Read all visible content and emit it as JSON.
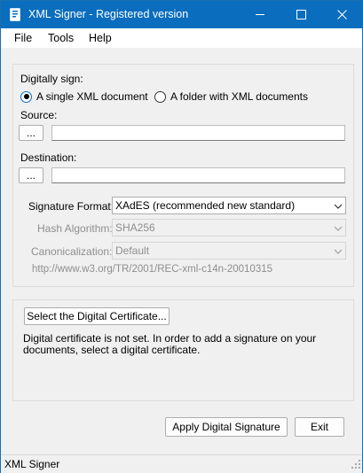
{
  "titlebar": {
    "title": "XML Signer - Registered version",
    "controls": [
      "minimize-icon",
      "maximize-icon",
      "close-icon"
    ]
  },
  "menu": {
    "file": "File",
    "tools": "Tools",
    "help": "Help"
  },
  "sign": {
    "heading": "Digitally sign:",
    "options": {
      "single": "A single XML document",
      "folder": "A folder with XML documents"
    },
    "selected": "single"
  },
  "source": {
    "label": "Source:",
    "browse": "...",
    "value": ""
  },
  "destination": {
    "label": "Destination:",
    "browse": "...",
    "value": ""
  },
  "signature": {
    "format_label": "Signature Format:",
    "format_value": "XAdES (recommended new standard)",
    "hash_label": "Hash Algorithm:",
    "hash_value": "SHA256",
    "canon_label": "Canonicalization:",
    "canon_value": "Default",
    "canon_url": "http://www.w3.org/TR/2001/REC-xml-c14n-20010315"
  },
  "certificate": {
    "select_button": "Select the Digital Certificate...",
    "message": "Digital certificate is not set. In order to add a signature on your documents, select a digital certificate."
  },
  "actions": {
    "apply": "Apply Digital Signature",
    "exit": "Exit"
  },
  "status": {
    "text": "XML Signer"
  },
  "colors": {
    "titlebar": "#0a6dbd",
    "window_bg": "#f0f0f0",
    "disabled_text": "#8e8e8e"
  }
}
